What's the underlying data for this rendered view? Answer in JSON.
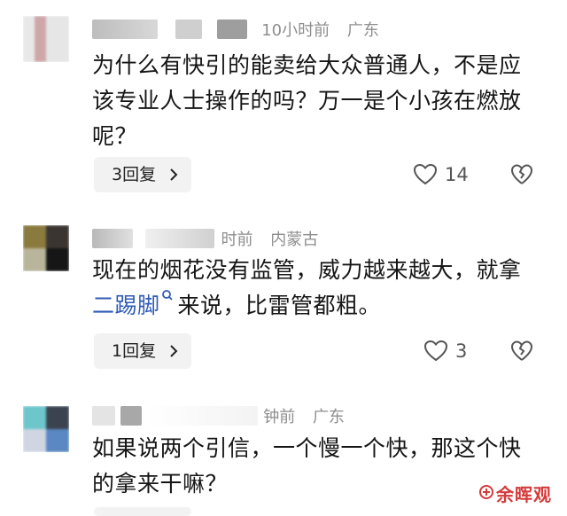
{
  "comments": [
    {
      "time": "10小时前",
      "location": "广东",
      "text": "为什么有快引的能卖给大众普通人，不是应该专业人士操作的吗？万一是个小孩在燃放呢？",
      "reply_label": "3回复",
      "like_count": "14"
    },
    {
      "time": "时前",
      "location": "内蒙古",
      "text_before": "现在的烟花没有监管，威力越来越大，就拿",
      "link_text": "二踢脚",
      "text_after": "来说，比雷管都粗。",
      "reply_label": "1回复",
      "like_count": "3"
    },
    {
      "time": "钟前",
      "location": "广东",
      "text": "如果说两个引信，一个慢一个快，那这个快的拿来干嘛？"
    }
  ],
  "icons": {
    "like": "heart-icon",
    "dislike": "broken-heart-icon",
    "reply_chevron": "chevron-right-icon",
    "link": "search-icon"
  },
  "watermark": "余晖观",
  "colors": {
    "link": "#2f5bb7",
    "watermark": "#d43a3a"
  }
}
